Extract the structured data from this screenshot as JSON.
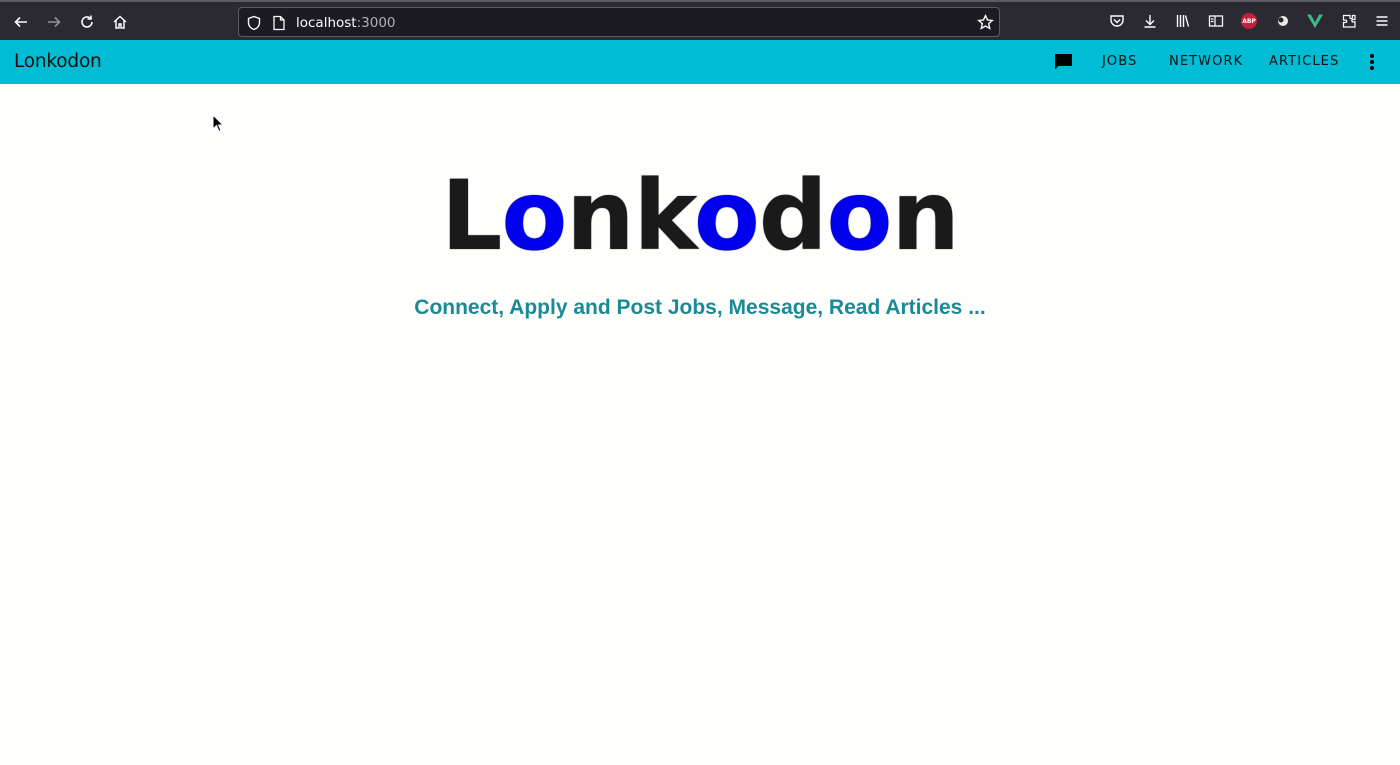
{
  "browser": {
    "url_host": "localhost",
    "url_port": ":3000",
    "icons": [
      "back-icon",
      "forward-icon",
      "reload-icon",
      "home-icon",
      "shield-icon",
      "page-icon",
      "bookmark-star-icon",
      "pocket-icon",
      "download-icon",
      "library-icon",
      "reader-view-icon",
      "adblock-plus-icon",
      "extension-icon",
      "vue-devtools-icon",
      "extensions-icon",
      "menu-icon"
    ],
    "abp_label": "ABP"
  },
  "appbar": {
    "title": "Lonkodon",
    "links": {
      "jobs": "JOBS",
      "network": "NETWORK",
      "articles": "ARTICLES"
    },
    "color": "#00bcd4"
  },
  "hero": {
    "title_parts": [
      "L",
      "o",
      "nk",
      "o",
      "d",
      "o",
      "n"
    ],
    "subtitle": "Connect, Apply and Post Jobs, Message, Read Articles ...",
    "accent_color": "#0000ee",
    "subtitle_color": "#1a8a96"
  }
}
